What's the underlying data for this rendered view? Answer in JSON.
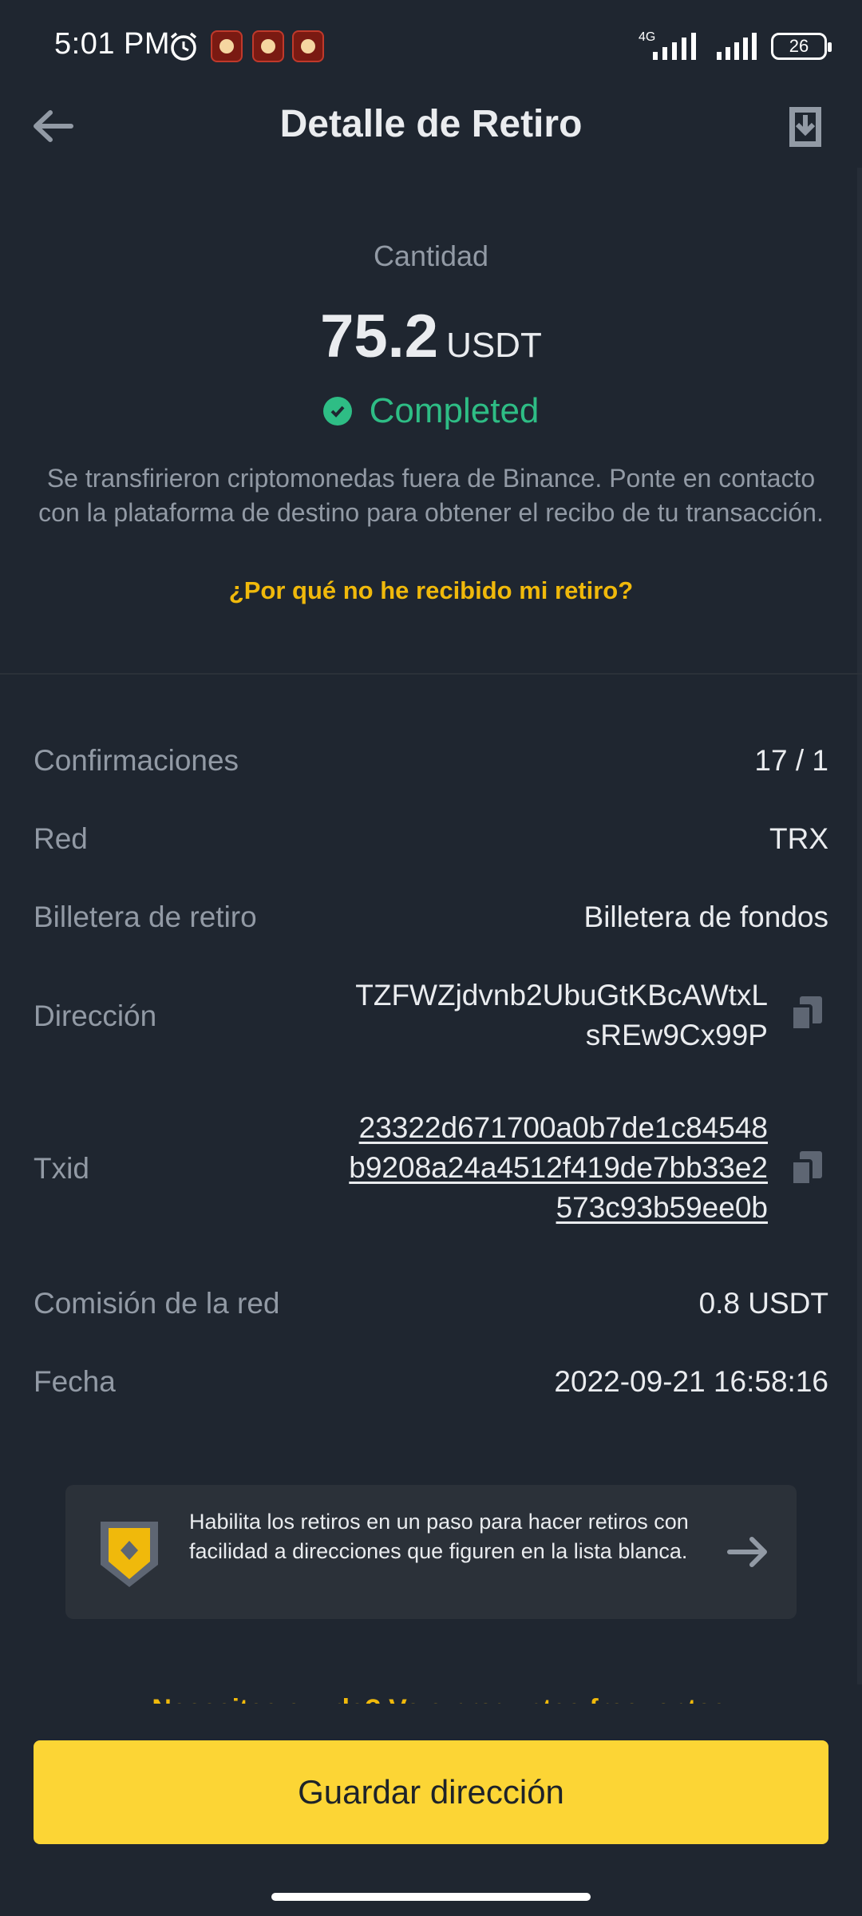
{
  "status_bar": {
    "time": "5:01 PM",
    "network": "4G",
    "battery": "26"
  },
  "header": {
    "title": "Detalle de Retiro"
  },
  "summary": {
    "amount_label": "Cantidad",
    "amount": "75.2",
    "unit": "USDT",
    "status": "Completed",
    "info": "Se transfirieron criptomonedas fuera de Binance. Ponte en contacto con la plataforma de destino para obtener el recibo de tu transacción.",
    "help_link": "¿Por qué no he recibido mi retiro?"
  },
  "details": {
    "confirmations_label": "Confirmaciones",
    "confirmations_value": "17 / 1",
    "network_label": "Red",
    "network_value": "TRX",
    "wallet_label": "Billetera de retiro",
    "wallet_value": "Billetera de fondos",
    "address_label": "Dirección",
    "address_line1": "TZFWZjdvnb2UbuGtKBcAWtxL",
    "address_line2": "sREw9Cx99P",
    "txid_label": "Txid",
    "txid_line1": "23322d671700a0b7de1c84548",
    "txid_line2": "b9208a24a4512f419de7bb33e2",
    "txid_line3": "573c93b59ee0b",
    "fee_label": "Comisión de la red",
    "fee_value": "0.8 USDT",
    "date_label": "Fecha",
    "date_value": "2022-09-21 16:58:16"
  },
  "banner": {
    "text": "Habilita los retiros en un paso para hacer retiros con facilidad a direcciones que figuren en la lista blanca."
  },
  "faq_link": "¿Necesitas ayuda? Ve a preguntas frecuentes",
  "footer": {
    "save_label": "Guardar dirección"
  },
  "colors": {
    "background": "#1f2630",
    "accent": "#fcd535",
    "link": "#f0b90b",
    "success": "#2ebd85"
  },
  "icons": [
    "back-arrow-icon",
    "download-receipt-icon",
    "check-circle-icon",
    "copy-icon",
    "shield-icon",
    "arrow-right-icon",
    "alarm-icon"
  ]
}
